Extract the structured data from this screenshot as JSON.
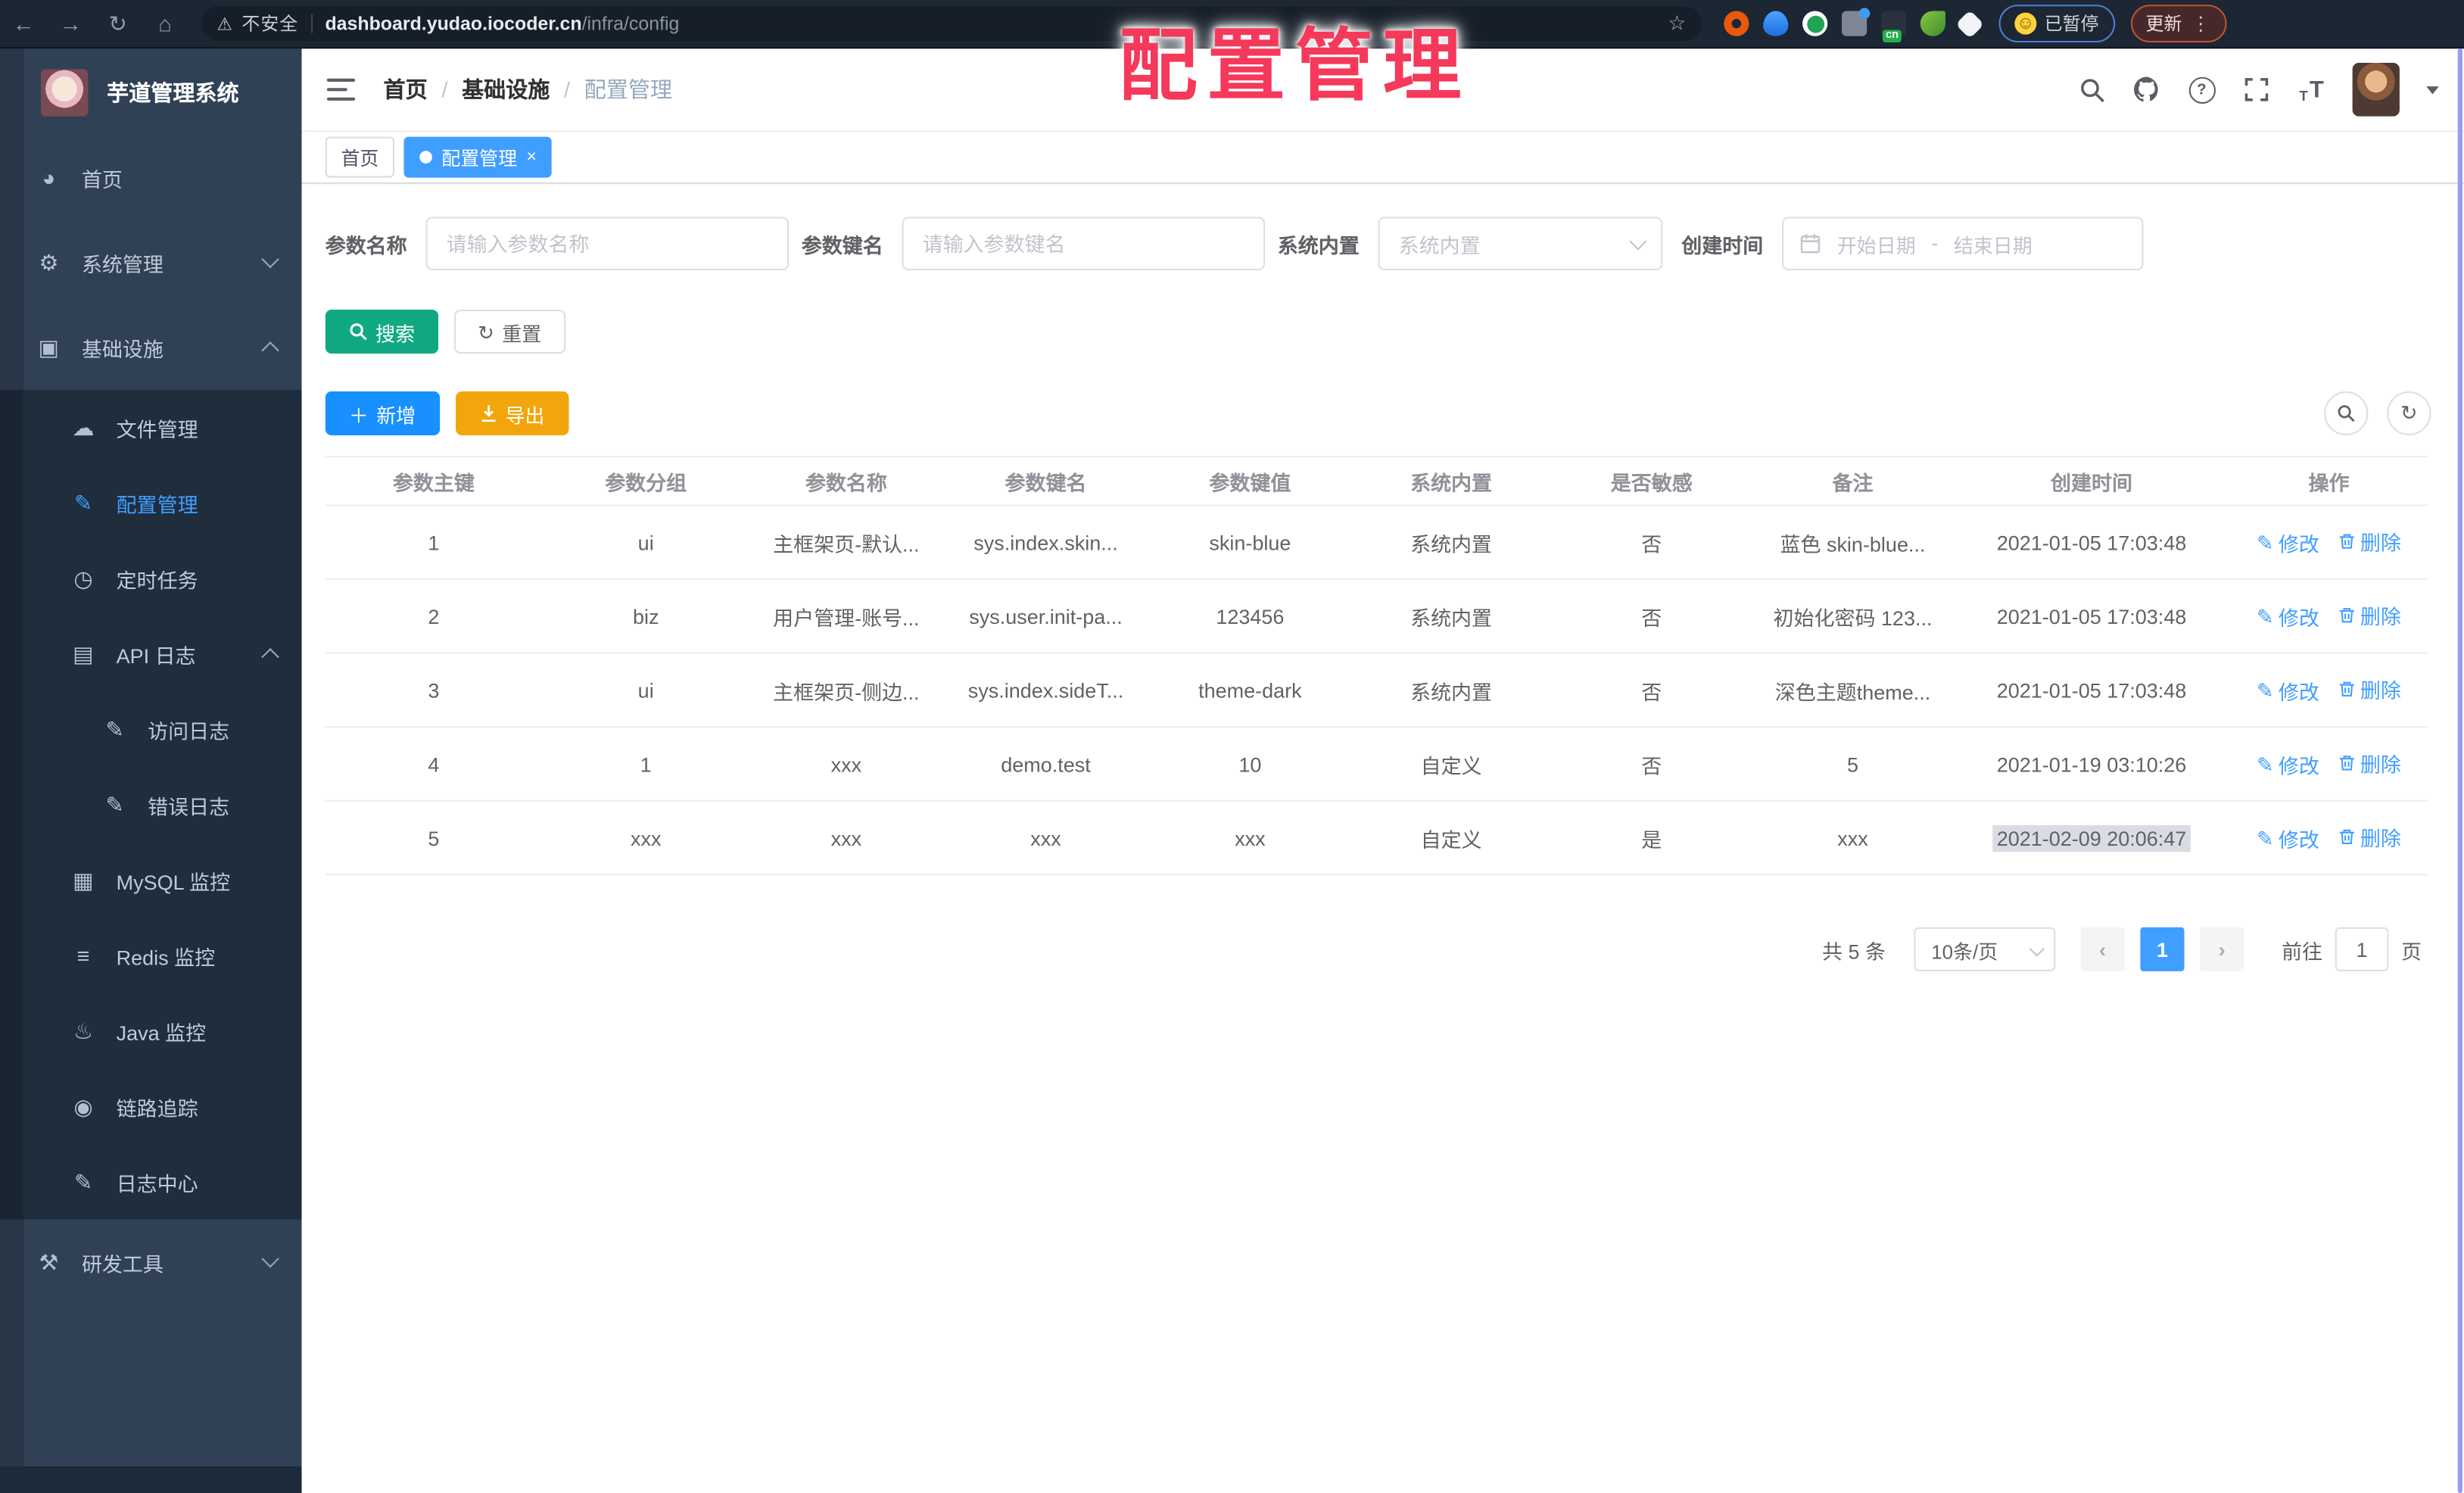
{
  "colors": {
    "accent": "#409eff",
    "search_button": "#11a983",
    "add_button": "#1890ff",
    "export_button": "#f2a60c",
    "watermark": "#f5395a",
    "sidebar_bg": "#304156",
    "submenu_bg": "#1f2d3d",
    "tab_active_bg": "#409eff"
  },
  "watermark": "配置管理",
  "browser": {
    "security_label": "不安全",
    "url_host": "dashboard.yudao.iocoder.cn",
    "url_path": "/infra/config",
    "paused_label": "已暂停",
    "update_label": "更新",
    "cn_badge": "cn"
  },
  "sidebar": {
    "title": "芋道管理系统",
    "items": [
      {
        "label": "首页"
      },
      {
        "label": "系统管理"
      },
      {
        "label": "基础设施"
      },
      {
        "label": "文件管理"
      },
      {
        "label": "配置管理"
      },
      {
        "label": "定时任务"
      },
      {
        "label": "API 日志"
      },
      {
        "label": "访问日志"
      },
      {
        "label": "错误日志"
      },
      {
        "label": "MySQL 监控"
      },
      {
        "label": "Redis 监控"
      },
      {
        "label": "Java 监控"
      },
      {
        "label": "链路追踪"
      },
      {
        "label": "日志中心"
      },
      {
        "label": "研发工具"
      }
    ]
  },
  "header": {
    "breadcrumb": [
      "首页",
      "基础设施",
      "配置管理"
    ]
  },
  "tabs": [
    {
      "label": "首页"
    },
    {
      "label": "配置管理"
    }
  ],
  "filters": {
    "name_label": "参数名称",
    "name_placeholder": "请输入参数名称",
    "key_label": "参数键名",
    "key_placeholder": "请输入参数键名",
    "builtin_label": "系统内置",
    "builtin_placeholder": "系统内置",
    "time_label": "创建时间",
    "start_placeholder": "开始日期",
    "range_separator": "-",
    "end_placeholder": "结束日期"
  },
  "toolbar": {
    "search_label": "搜索",
    "reset_label": "重置",
    "add_label": "新增",
    "export_label": "导出"
  },
  "table": {
    "columns": [
      "参数主键",
      "参数分组",
      "参数名称",
      "参数键名",
      "参数键值",
      "系统内置",
      "是否敏感",
      "备注",
      "创建时间",
      "操作"
    ],
    "edit_label": "修改",
    "delete_label": "删除",
    "rows": [
      {
        "id": "1",
        "group": "ui",
        "name": "主框架页-默认...",
        "key": "sys.index.skin...",
        "value": "skin-blue",
        "builtin": "系统内置",
        "sensitive": "否",
        "remark": "蓝色 skin-blue...",
        "created": "2021-01-05 17:03:48"
      },
      {
        "id": "2",
        "group": "biz",
        "name": "用户管理-账号...",
        "key": "sys.user.init-pa...",
        "value": "123456",
        "builtin": "系统内置",
        "sensitive": "否",
        "remark": "初始化密码 123...",
        "created": "2021-01-05 17:03:48"
      },
      {
        "id": "3",
        "group": "ui",
        "name": "主框架页-侧边...",
        "key": "sys.index.sideT...",
        "value": "theme-dark",
        "builtin": "系统内置",
        "sensitive": "否",
        "remark": "深色主题theme...",
        "created": "2021-01-05 17:03:48"
      },
      {
        "id": "4",
        "group": "1",
        "name": "xxx",
        "key": "demo.test",
        "value": "10",
        "builtin": "自定义",
        "sensitive": "否",
        "remark": "5",
        "created": "2021-01-19 03:10:26"
      },
      {
        "id": "5",
        "group": "xxx",
        "name": "xxx",
        "key": "xxx",
        "value": "xxx",
        "builtin": "自定义",
        "sensitive": "是",
        "remark": "xxx",
        "created": "2021-02-09 20:06:47"
      }
    ]
  },
  "pagination": {
    "total": "共 5 条",
    "page_size": "10条/页",
    "current_page": "1",
    "goto_label": "前往",
    "goto_value": "1",
    "page_unit": "页"
  }
}
